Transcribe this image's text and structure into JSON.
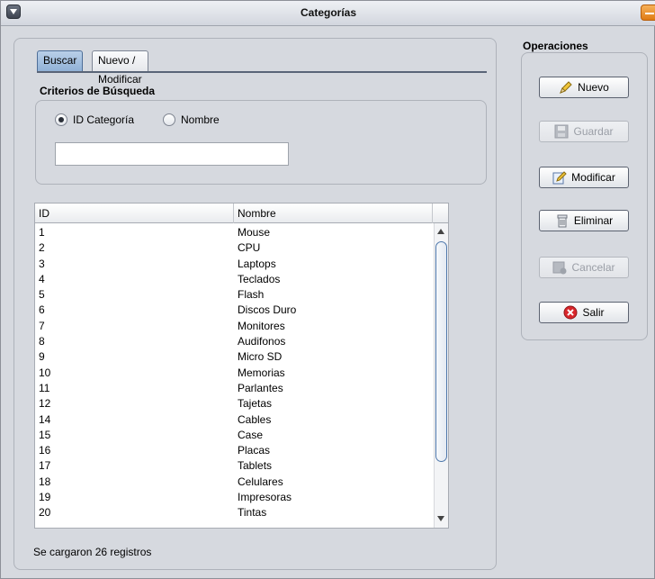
{
  "window": {
    "title": "Categorías"
  },
  "operations": {
    "title": "Operaciones",
    "buttons": {
      "nuevo": "Nuevo",
      "guardar": "Guardar",
      "modificar": "Modificar",
      "eliminar": "Eliminar",
      "cancelar": "Cancelar",
      "salir": "Salir"
    }
  },
  "tabs": [
    "Buscar",
    "Nuevo / Modificar"
  ],
  "search": {
    "title": "Criterios de Búsqueda",
    "radio_id": "ID Categoría",
    "radio_nombre": "Nombre",
    "selected": "ID Categoría",
    "input_value": ""
  },
  "table": {
    "columns": [
      "ID",
      "Nombre"
    ],
    "rows": [
      [
        "1",
        "Mouse"
      ],
      [
        "2",
        "CPU"
      ],
      [
        "3",
        "Laptops"
      ],
      [
        "4",
        "Teclados"
      ],
      [
        "5",
        "Flash"
      ],
      [
        "6",
        "Discos Duro"
      ],
      [
        "7",
        "Monitores"
      ],
      [
        "8",
        "Audifonos"
      ],
      [
        "9",
        "Micro SD"
      ],
      [
        "10",
        "Memorias"
      ],
      [
        "11",
        "Parlantes"
      ],
      [
        "12",
        "Tajetas"
      ],
      [
        "14",
        "Cables"
      ],
      [
        "15",
        "Case"
      ],
      [
        "16",
        "Placas"
      ],
      [
        "17",
        "Tablets"
      ],
      [
        "18",
        "Celulares"
      ],
      [
        "19",
        "Impresoras"
      ],
      [
        "20",
        "Tintas"
      ]
    ]
  },
  "status": "Se cargaron 26 registros",
  "colors": {
    "accent": "#8fb0d6",
    "close": "#e07b14",
    "danger": "#d9262b"
  }
}
